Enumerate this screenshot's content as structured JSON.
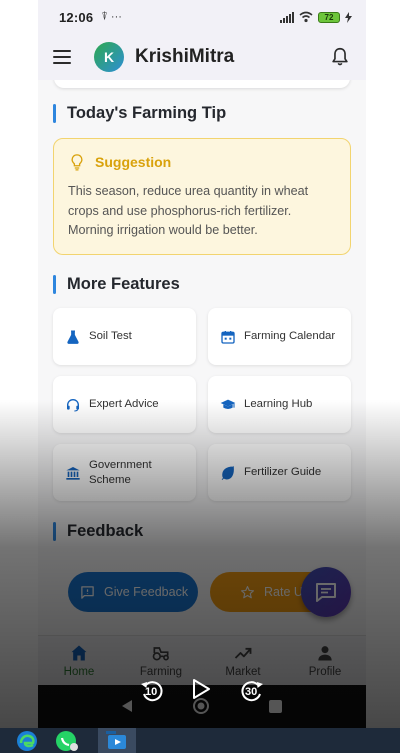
{
  "status": {
    "time": "12:06",
    "icons": "⍒ ···",
    "battery": "72"
  },
  "app": {
    "logo_letter": "K",
    "title": "KrishiMitra"
  },
  "tip_section": {
    "title": "Today's Farming Tip",
    "card_title": "Suggestion",
    "text": "This season, reduce urea quantity in wheat crops and use phosphorus-rich fertilizer. Morning irrigation would be better."
  },
  "features_section": {
    "title": "More Features",
    "items": [
      {
        "label": "Soil Test",
        "icon": "flask-icon"
      },
      {
        "label": "Farming Calendar",
        "icon": "calendar-icon"
      },
      {
        "label": "Expert Advice",
        "icon": "headset-icon"
      },
      {
        "label": "Learning Hub",
        "icon": "graduation-cap-icon"
      },
      {
        "label": "Government Scheme",
        "icon": "bank-icon"
      },
      {
        "label": "Fertilizer Guide",
        "icon": "leaf-icon"
      }
    ]
  },
  "feedback_section": {
    "title": "Feedback",
    "give_label": "Give Feedback",
    "rate_label": "Rate U"
  },
  "bottom_nav": [
    {
      "label": "Home",
      "icon": "home-icon",
      "active": true
    },
    {
      "label": "Farming",
      "icon": "tractor-icon",
      "active": false
    },
    {
      "label": "Market",
      "icon": "trending-up-icon",
      "active": false
    },
    {
      "label": "Profile",
      "icon": "person-icon",
      "active": false
    }
  ],
  "video_controls": {
    "rewind": "10",
    "forward": "30"
  },
  "colors": {
    "accent": "#2e86de",
    "tip_border": "#f2d46f",
    "tip_title": "#d9a20c",
    "active_nav": "#2e7d32"
  }
}
